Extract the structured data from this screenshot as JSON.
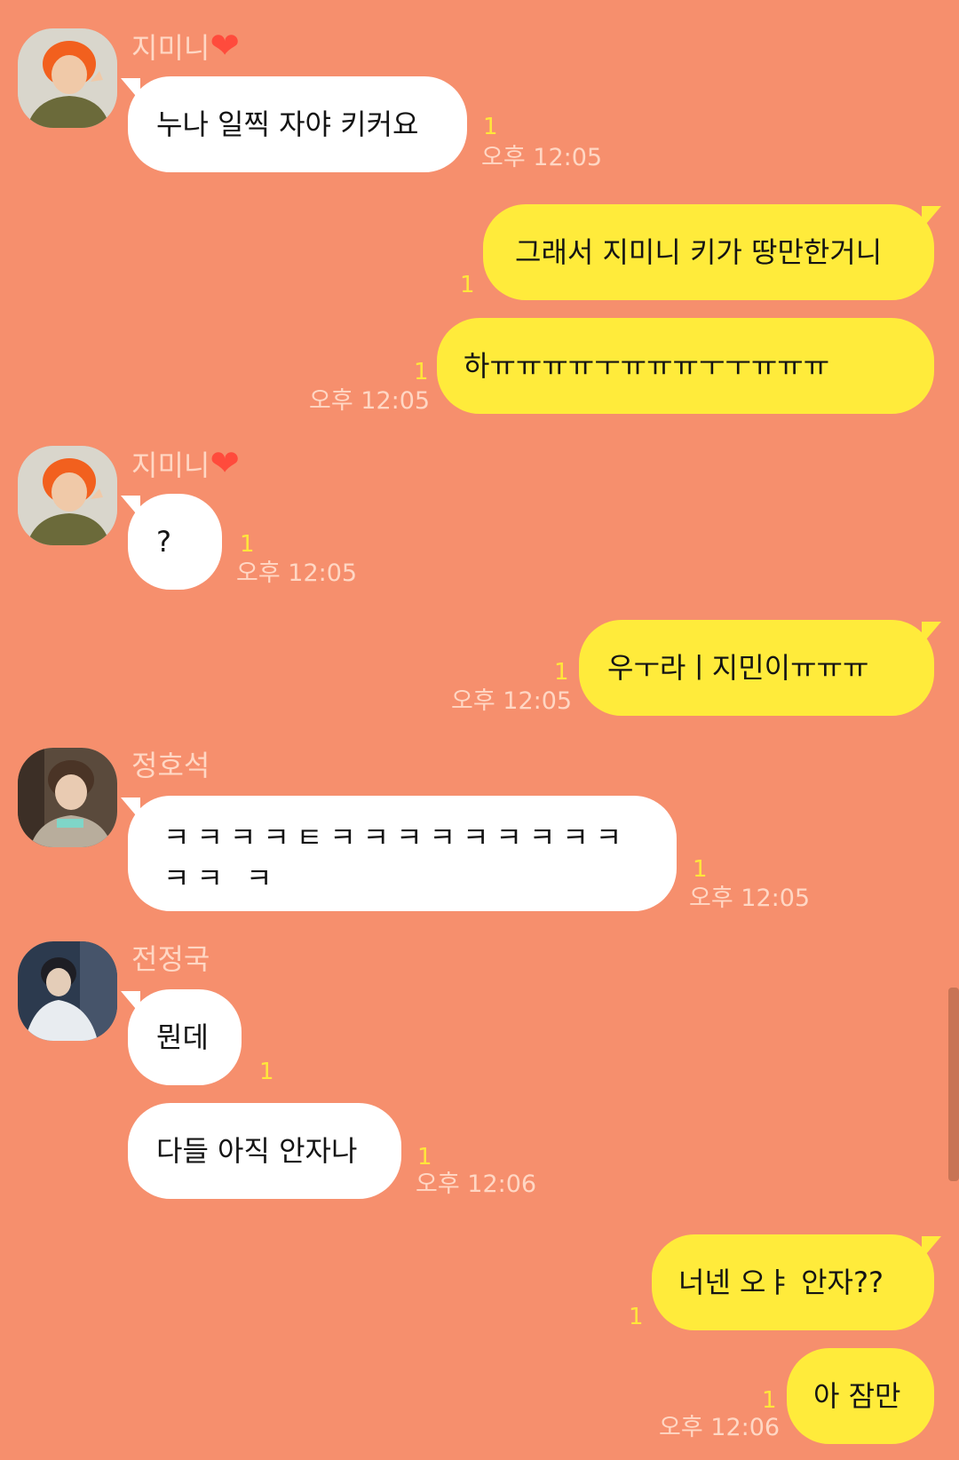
{
  "contacts": {
    "jimin": {
      "name": "지미니",
      "heart": "❤"
    },
    "hoseok": {
      "name": "정호석"
    },
    "jungkook": {
      "name": "전정국"
    }
  },
  "messages": [
    {
      "id": "m1",
      "sender": "jimin",
      "text": "누나 일찍 자야 키커요",
      "unread": "1",
      "time": "오후 12:05"
    },
    {
      "id": "m2",
      "sender": "me",
      "text": "그래서 지미니 키가 땅만한거니",
      "unread": "1",
      "time": ""
    },
    {
      "id": "m3",
      "sender": "me",
      "text": "하ㅠㅠㅠㅠㅜㅠㅠㅠㅜㅜㅠㅠㅠ",
      "unread": "1",
      "time": "오후 12:05"
    },
    {
      "id": "m4",
      "sender": "jimin",
      "text": "?",
      "unread": "1",
      "time": "오후 12:05"
    },
    {
      "id": "m5",
      "sender": "me",
      "text": "우ㅜ라ㅣ지민이ㅠㅠㅠ",
      "unread": "1",
      "time": "오후 12:05"
    },
    {
      "id": "m6",
      "sender": "hoseok",
      "text": "ㅋㅋㅋㅋㅌㅋㅋㅋㅋㅋㅋㅋㅋㅋㅋㅋ ㅋ",
      "unread": "1",
      "time": "오후 12:05"
    },
    {
      "id": "m7",
      "sender": "jungkook",
      "text": "뭔데",
      "unread": "1",
      "time": ""
    },
    {
      "id": "m8",
      "sender": "jungkook",
      "text": "다들 아직 안자나",
      "unread": "1",
      "time": "오후 12:06"
    },
    {
      "id": "m9",
      "sender": "me",
      "text": "너넨 오ㅑ 안자??",
      "unread": "1",
      "time": ""
    },
    {
      "id": "m10",
      "sender": "me",
      "text": "아 잠만",
      "unread": "1",
      "time": "오후 12:06"
    }
  ],
  "colors": {
    "background": "#f68f6d",
    "bubble_in": "#ffffff",
    "bubble_out": "#ffeb3b",
    "unread": "#ffe63b",
    "meta_text": "#ffd7c4"
  }
}
